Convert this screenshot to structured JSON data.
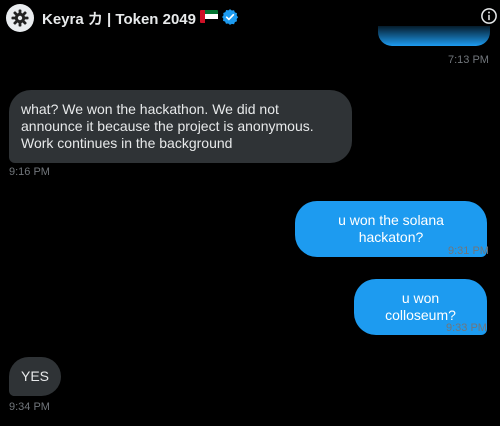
{
  "header": {
    "contact_name": "Keyra カ | Token 2049",
    "flag_icon": "uae-flag-icon",
    "verified_icon": "verified-badge-icon",
    "info_icon": "info-icon",
    "avatar_icon": "gear-avatar-icon"
  },
  "colors": {
    "background": "#000000",
    "sent_bubble": "#1d9bf0",
    "received_bubble": "#2f3336",
    "timestamp": "#71767b",
    "verified": "#1d9bf0"
  },
  "messages": [
    {
      "direction": "sent",
      "text": "",
      "time": "7:13 PM"
    },
    {
      "direction": "received",
      "text": "what? We won the hackathon. We did not announce it because the project is anonymous. Work continues in the background",
      "time": "9:16 PM"
    },
    {
      "direction": "sent",
      "text": "u won the solana hackaton?",
      "time": "9:31 PM"
    },
    {
      "direction": "sent",
      "text": "u won colloseum?",
      "time": "9:33 PM"
    },
    {
      "direction": "received",
      "text": "YES",
      "time": "9:34 PM"
    }
  ]
}
